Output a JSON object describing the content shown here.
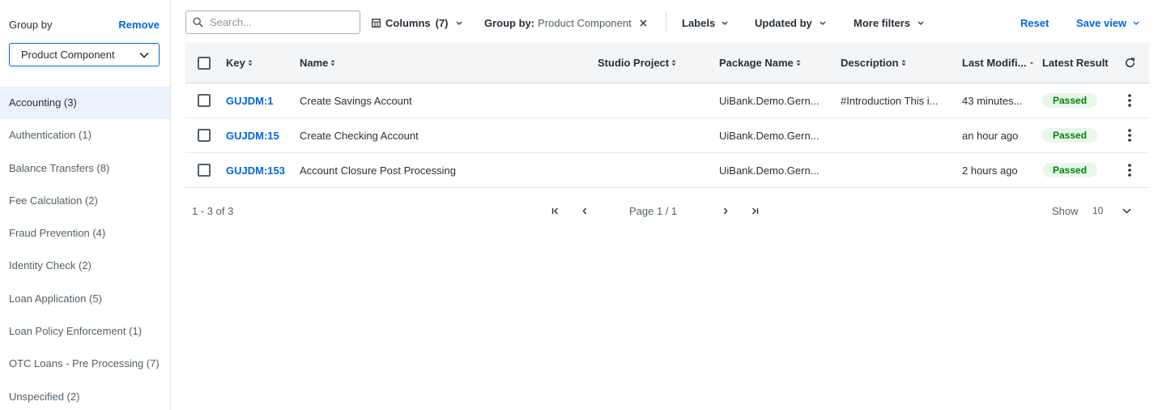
{
  "sidebar": {
    "title": "Group by",
    "remove_label": "Remove",
    "selected": "Product Component",
    "items": [
      {
        "label": "Accounting (3)"
      },
      {
        "label": "Authentication (1)"
      },
      {
        "label": "Balance Transfers (8)"
      },
      {
        "label": "Fee Calculation (2)"
      },
      {
        "label": "Fraud Prevention (4)"
      },
      {
        "label": "Identity Check (2)"
      },
      {
        "label": "Loan Application (5)"
      },
      {
        "label": "Loan Policy Enforcement (1)"
      },
      {
        "label": "OTC Loans - Pre Processing (7)"
      },
      {
        "label": "Unspecified (2)"
      }
    ]
  },
  "toolbar": {
    "search_placeholder": "Search...",
    "columns_label": "Columns",
    "columns_count": "(7)",
    "groupby_prefix": "Group by:",
    "groupby_value": "Product Component",
    "labels": "Labels",
    "updated_by": "Updated by",
    "more_filters": "More filters",
    "reset": "Reset",
    "save_view": "Save view"
  },
  "table": {
    "columns": {
      "key": "Key",
      "name": "Name",
      "studio_project": "Studio Project",
      "package_name": "Package Name",
      "description": "Description",
      "last_modified": "Last Modifi...",
      "latest_result": "Latest Result"
    },
    "rows": [
      {
        "key": "GUJDM:1",
        "name": "Create Savings Account",
        "studio_project": "",
        "package": "UiBank.Demo.Gern...",
        "description": "#Introduction This i...",
        "modified": "43 minutes...",
        "result": "Passed"
      },
      {
        "key": "GUJDM:15",
        "name": "Create Checking Account",
        "studio_project": "",
        "package": "UiBank.Demo.Gern...",
        "description": "",
        "modified": "an hour ago",
        "result": "Passed"
      },
      {
        "key": "GUJDM:153",
        "name": "Account Closure Post Processing",
        "studio_project": "",
        "package": "UiBank.Demo.Gern...",
        "description": "",
        "modified": "2 hours ago",
        "result": "Passed"
      }
    ]
  },
  "pagination": {
    "range": "1 - 3 of 3",
    "page": "Page 1 / 1",
    "show_label": "Show",
    "page_size": "10"
  },
  "colors": {
    "accent": "#0067df",
    "passed_bg": "#e8f7ea",
    "passed_text": "#038108",
    "active_group_bg": "#e9f1fa"
  },
  "icons": [
    "search-icon",
    "columns-icon",
    "chevron-down-icon",
    "close-icon",
    "sort-icon",
    "sort-desc-icon",
    "refresh-icon",
    "kebab-icon",
    "first-page-icon",
    "prev-page-icon",
    "next-page-icon",
    "last-page-icon"
  ]
}
